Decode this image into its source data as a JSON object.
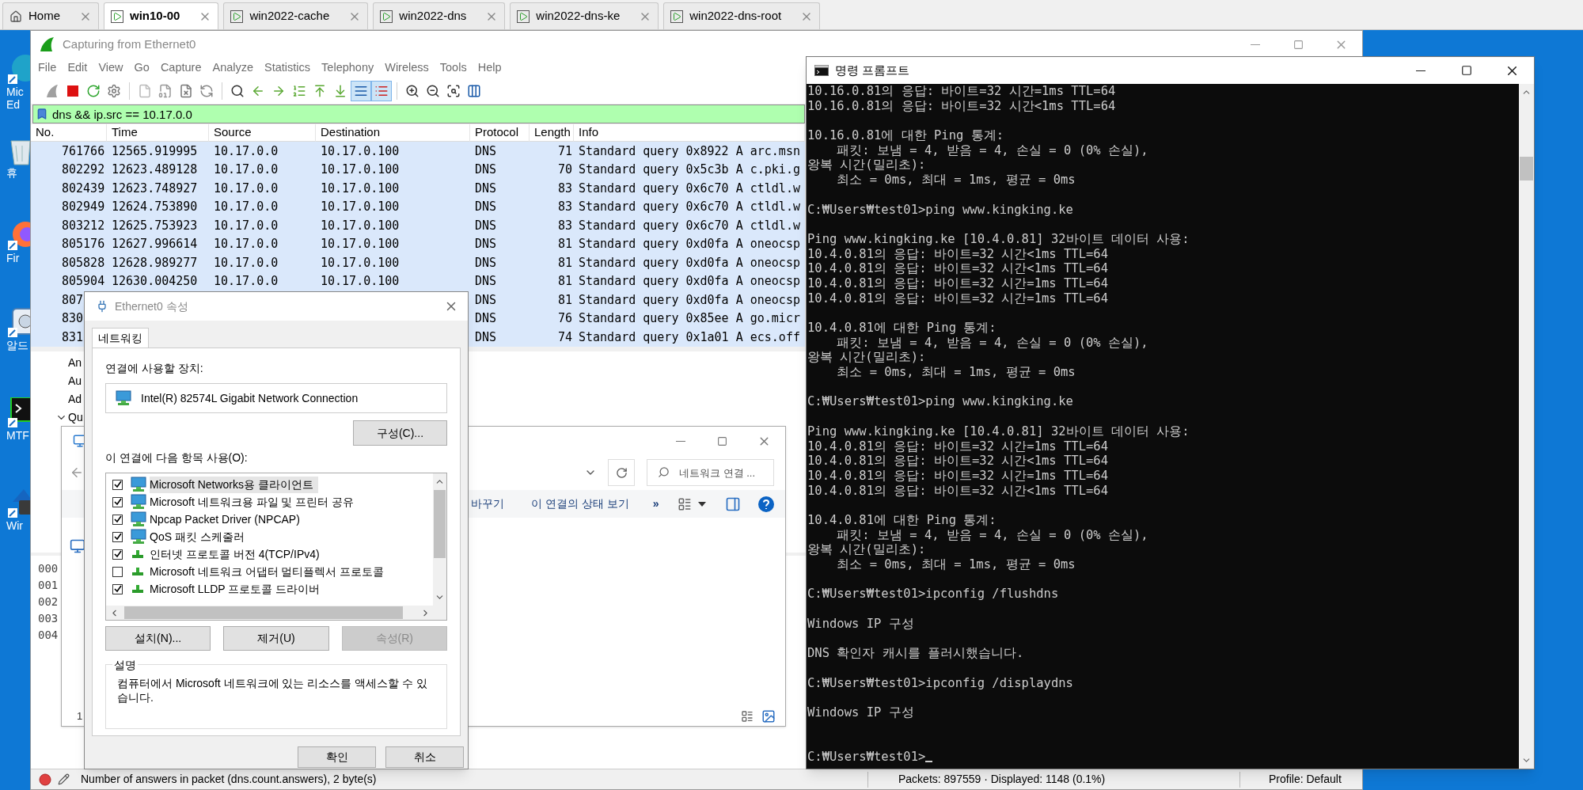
{
  "vm_tabs": [
    {
      "label": "Home",
      "kind": "home",
      "selected": false
    },
    {
      "label": "win10-00",
      "kind": "vm",
      "selected": true
    },
    {
      "label": "win2022-cache",
      "kind": "vm",
      "selected": false
    },
    {
      "label": "win2022-dns",
      "kind": "vm",
      "selected": false
    },
    {
      "label": "win2022-dns-ke",
      "kind": "vm",
      "selected": false
    },
    {
      "label": "win2022-dns-root",
      "kind": "vm",
      "selected": false
    }
  ],
  "desktop_icons": [
    {
      "kind": "browser",
      "lines": [
        "Mic",
        "Ed"
      ]
    },
    {
      "kind": "recycle",
      "lines": [
        "휴"
      ]
    },
    {
      "kind": "firefox",
      "lines": [
        "Fir"
      ]
    },
    {
      "kind": "disk",
      "lines": [
        "알드"
      ]
    },
    {
      "kind": "terminal",
      "lines": [
        "MTF"
      ]
    },
    {
      "kind": "lock",
      "lines": [
        "Wir"
      ]
    }
  ],
  "wireshark": {
    "title": "Capturing from Ethernet0",
    "menu": [
      "File",
      "Edit",
      "View",
      "Go",
      "Capture",
      "Analyze",
      "Statistics",
      "Telephony",
      "Wireless",
      "Tools",
      "Help"
    ],
    "toolbar": [
      {
        "kind": "start",
        "pressed": false
      },
      {
        "kind": "stop",
        "pressed": false
      },
      {
        "kind": "restart",
        "pressed": false
      },
      {
        "kind": "options",
        "pressed": false
      },
      {
        "kind": "open",
        "pressed": false
      },
      {
        "kind": "save",
        "pressed": false
      },
      {
        "kind": "close",
        "pressed": false
      },
      {
        "kind": "reload",
        "pressed": false
      },
      {
        "kind": "find",
        "pressed": false
      },
      {
        "kind": "back",
        "pressed": false
      },
      {
        "kind": "forward",
        "pressed": false
      },
      {
        "kind": "goto",
        "pressed": false
      },
      {
        "kind": "first",
        "pressed": false
      },
      {
        "kind": "last",
        "pressed": false
      },
      {
        "kind": "autoscroll",
        "pressed": true
      },
      {
        "kind": "colorize",
        "pressed": true
      },
      {
        "kind": "zoomin",
        "pressed": false
      },
      {
        "kind": "zoomout",
        "pressed": false
      },
      {
        "kind": "zoomnormal",
        "pressed": false
      },
      {
        "kind": "resize",
        "pressed": false
      }
    ],
    "filter": "dns && ip.src == 10.17.0.0",
    "columns": [
      "No.",
      "Time",
      "Source",
      "Destination",
      "Protocol",
      "Length",
      "Info"
    ],
    "rows": [
      {
        "no": "761766",
        "time": "12565.919995",
        "source": "10.17.0.0",
        "destination": "10.17.0.100",
        "protocol": "DNS",
        "length": "71",
        "info": "Standard query 0x8922 A arc.msn"
      },
      {
        "no": "802292",
        "time": "12623.489128",
        "source": "10.17.0.0",
        "destination": "10.17.0.100",
        "protocol": "DNS",
        "length": "70",
        "info": "Standard query 0x5c3b A c.pki.g"
      },
      {
        "no": "802439",
        "time": "12623.748927",
        "source": "10.17.0.0",
        "destination": "10.17.0.100",
        "protocol": "DNS",
        "length": "83",
        "info": "Standard query 0x6c70 A ctldl.w"
      },
      {
        "no": "802949",
        "time": "12624.753890",
        "source": "10.17.0.0",
        "destination": "10.17.0.100",
        "protocol": "DNS",
        "length": "83",
        "info": "Standard query 0x6c70 A ctldl.w"
      },
      {
        "no": "803212",
        "time": "12625.753923",
        "source": "10.17.0.0",
        "destination": "10.17.0.100",
        "protocol": "DNS",
        "length": "83",
        "info": "Standard query 0x6c70 A ctldl.w"
      },
      {
        "no": "805176",
        "time": "12627.996614",
        "source": "10.17.0.0",
        "destination": "10.17.0.100",
        "protocol": "DNS",
        "length": "81",
        "info": "Standard query 0xd0fa A oneocsp"
      },
      {
        "no": "805828",
        "time": "12628.989277",
        "source": "10.17.0.0",
        "destination": "10.17.0.100",
        "protocol": "DNS",
        "length": "81",
        "info": "Standard query 0xd0fa A oneocsp"
      },
      {
        "no": "805904",
        "time": "12630.004250",
        "source": "10.17.0.0",
        "destination": "10.17.0.100",
        "protocol": "DNS",
        "length": "81",
        "info": "Standard query 0xd0fa A oneocsp"
      },
      {
        "no": "807",
        "protocol": "DNS",
        "length": "81",
        "info": "Standard query 0xd0fa A oneocsp"
      },
      {
        "no": "830",
        "protocol": "DNS",
        "length": "76",
        "info": "Standard query 0x85ee A go.micr"
      },
      {
        "no": "831",
        "protocol": "DNS",
        "length": "74",
        "info": "Standard query 0x1a01 A ecs.off"
      }
    ],
    "details": [
      {
        "label": "An"
      },
      {
        "label": "Au"
      },
      {
        "label": "Ad"
      },
      {
        "label": "Qu",
        "expanded": true
      }
    ],
    "bytes_offsets": [
      "000",
      "001",
      "002",
      "003",
      "004"
    ],
    "status": {
      "field_info": "Number of answers in packet (dns.count.answers), 2 byte(s)",
      "packets": "Packets: 897559 · Displayed: 1148 (0.1%)",
      "profile": "Profile: Default"
    }
  },
  "explorer": {
    "search_placeholder": "네트워크 연결 ...",
    "toolbar": [
      "바꾸기",
      "이 연결의 상태 보기"
    ],
    "more": "»",
    "item_count": "1"
  },
  "dialog": {
    "title": "Ethernet0 속성",
    "tab": "네트워킹",
    "device_label": "연결에 사용할 장치:",
    "device": "Intel(R) 82574L Gigabit Network Connection",
    "configure": "구성(C)...",
    "items_label": "이 연결에 다음 항목 사용(O):",
    "items": [
      {
        "label": "Microsoft Networks용 클라이언트",
        "kind": "client",
        "checked": true,
        "selected": true
      },
      {
        "label": "Microsoft 네트워크용 파일 및 프린터 공유",
        "kind": "client",
        "checked": true,
        "selected": false
      },
      {
        "label": "Npcap Packet Driver (NPCAP)",
        "kind": "client",
        "checked": true,
        "selected": false
      },
      {
        "label": "QoS 패킷 스케줄러",
        "kind": "client",
        "checked": true,
        "selected": false
      },
      {
        "label": "인터넷 프로토콜 버전 4(TCP/IPv4)",
        "kind": "protocol",
        "checked": true,
        "selected": false
      },
      {
        "label": "Microsoft 네트워크 어댑터 멀티플렉서 프로토콜",
        "kind": "protocol",
        "checked": false,
        "selected": false
      },
      {
        "label": "Microsoft LLDP 프로토콜 드라이버",
        "kind": "protocol",
        "checked": true,
        "selected": false
      }
    ],
    "buttons": [
      {
        "label": "설치(N)...",
        "disabled": false
      },
      {
        "label": "제거(U)",
        "disabled": false
      },
      {
        "label": "속성(R)",
        "disabled": true
      }
    ],
    "description_title": "설명",
    "description": "컴퓨터에서 Microsoft 네트워크에 있는 리소스를 액세스할 수 있습니다.",
    "ok": "확인",
    "cancel": "취소"
  },
  "cmd": {
    "title": "명령 프롬프트",
    "lines": [
      {
        "kind": "text",
        "text": "10.16.0.81의 응답: 바이트=32 시간=1ms TTL=64"
      },
      {
        "kind": "text",
        "text": "10.16.0.81의 응답: 바이트=32 시간<1ms TTL=64"
      },
      {
        "kind": "blank"
      },
      {
        "kind": "text",
        "text": "10.16.0.81에 대한 Ping 통계:"
      },
      {
        "kind": "text",
        "text": "    패킷: 보냄 = 4, 받음 = 4, 손실 = 0 (0% 손실),"
      },
      {
        "kind": "text",
        "text": "왕복 시간(밀리초):"
      },
      {
        "kind": "text",
        "text": "    최소 = 0ms, 최대 = 1ms, 평균 = 0ms"
      },
      {
        "kind": "blank"
      },
      {
        "kind": "text",
        "text": "C:₩Users₩test01>ping www.kingking.ke"
      },
      {
        "kind": "blank"
      },
      {
        "kind": "text",
        "text": "Ping www.kingking.ke [10.4.0.81] 32바이트 데이터 사용:"
      },
      {
        "kind": "text",
        "text": "10.4.0.81의 응답: 바이트=32 시간<1ms TTL=64"
      },
      {
        "kind": "text",
        "text": "10.4.0.81의 응답: 바이트=32 시간<1ms TTL=64"
      },
      {
        "kind": "text",
        "text": "10.4.0.81의 응답: 바이트=32 시간=1ms TTL=64"
      },
      {
        "kind": "text",
        "text": "10.4.0.81의 응답: 바이트=32 시간=1ms TTL=64"
      },
      {
        "kind": "blank"
      },
      {
        "kind": "text",
        "text": "10.4.0.81에 대한 Ping 통계:"
      },
      {
        "kind": "text",
        "text": "    패킷: 보냄 = 4, 받음 = 4, 손실 = 0 (0% 손실),"
      },
      {
        "kind": "text",
        "text": "왕복 시간(밀리초):"
      },
      {
        "kind": "text",
        "text": "    최소 = 0ms, 최대 = 1ms, 평균 = 0ms"
      },
      {
        "kind": "blank"
      },
      {
        "kind": "text",
        "text": "C:₩Users₩test01>ping www.kingking.ke"
      },
      {
        "kind": "blank"
      },
      {
        "kind": "text",
        "text": "Ping www.kingking.ke [10.4.0.81] 32바이트 데이터 사용:"
      },
      {
        "kind": "text",
        "text": "10.4.0.81의 응답: 바이트=32 시간=1ms TTL=64"
      },
      {
        "kind": "text",
        "text": "10.4.0.81의 응답: 바이트=32 시간<1ms TTL=64"
      },
      {
        "kind": "text",
        "text": "10.4.0.81의 응답: 바이트=32 시간=1ms TTL=64"
      },
      {
        "kind": "text",
        "text": "10.4.0.81의 응답: 바이트=32 시간<1ms TTL=64"
      },
      {
        "kind": "blank"
      },
      {
        "kind": "text",
        "text": "10.4.0.81에 대한 Ping 통계:"
      },
      {
        "kind": "text",
        "text": "    패킷: 보냄 = 4, 받음 = 4, 손실 = 0 (0% 손실),"
      },
      {
        "kind": "text",
        "text": "왕복 시간(밀리초):"
      },
      {
        "kind": "text",
        "text": "    최소 = 0ms, 최대 = 1ms, 평균 = 0ms"
      },
      {
        "kind": "blank"
      },
      {
        "kind": "text",
        "text": "C:₩Users₩test01>ipconfig /flushdns"
      },
      {
        "kind": "blank"
      },
      {
        "kind": "text",
        "text": "Windows IP 구성"
      },
      {
        "kind": "blank"
      },
      {
        "kind": "text",
        "text": "DNS 확인자 캐시를 플러시했습니다."
      },
      {
        "kind": "blank"
      },
      {
        "kind": "text",
        "text": "C:₩Users₩test01>ipconfig /displaydns"
      },
      {
        "kind": "blank"
      },
      {
        "kind": "text",
        "text": "Windows IP 구성"
      },
      {
        "kind": "blank"
      },
      {
        "kind": "blank"
      },
      {
        "kind": "prompt",
        "text": "C:₩Users₩test01>"
      }
    ]
  }
}
